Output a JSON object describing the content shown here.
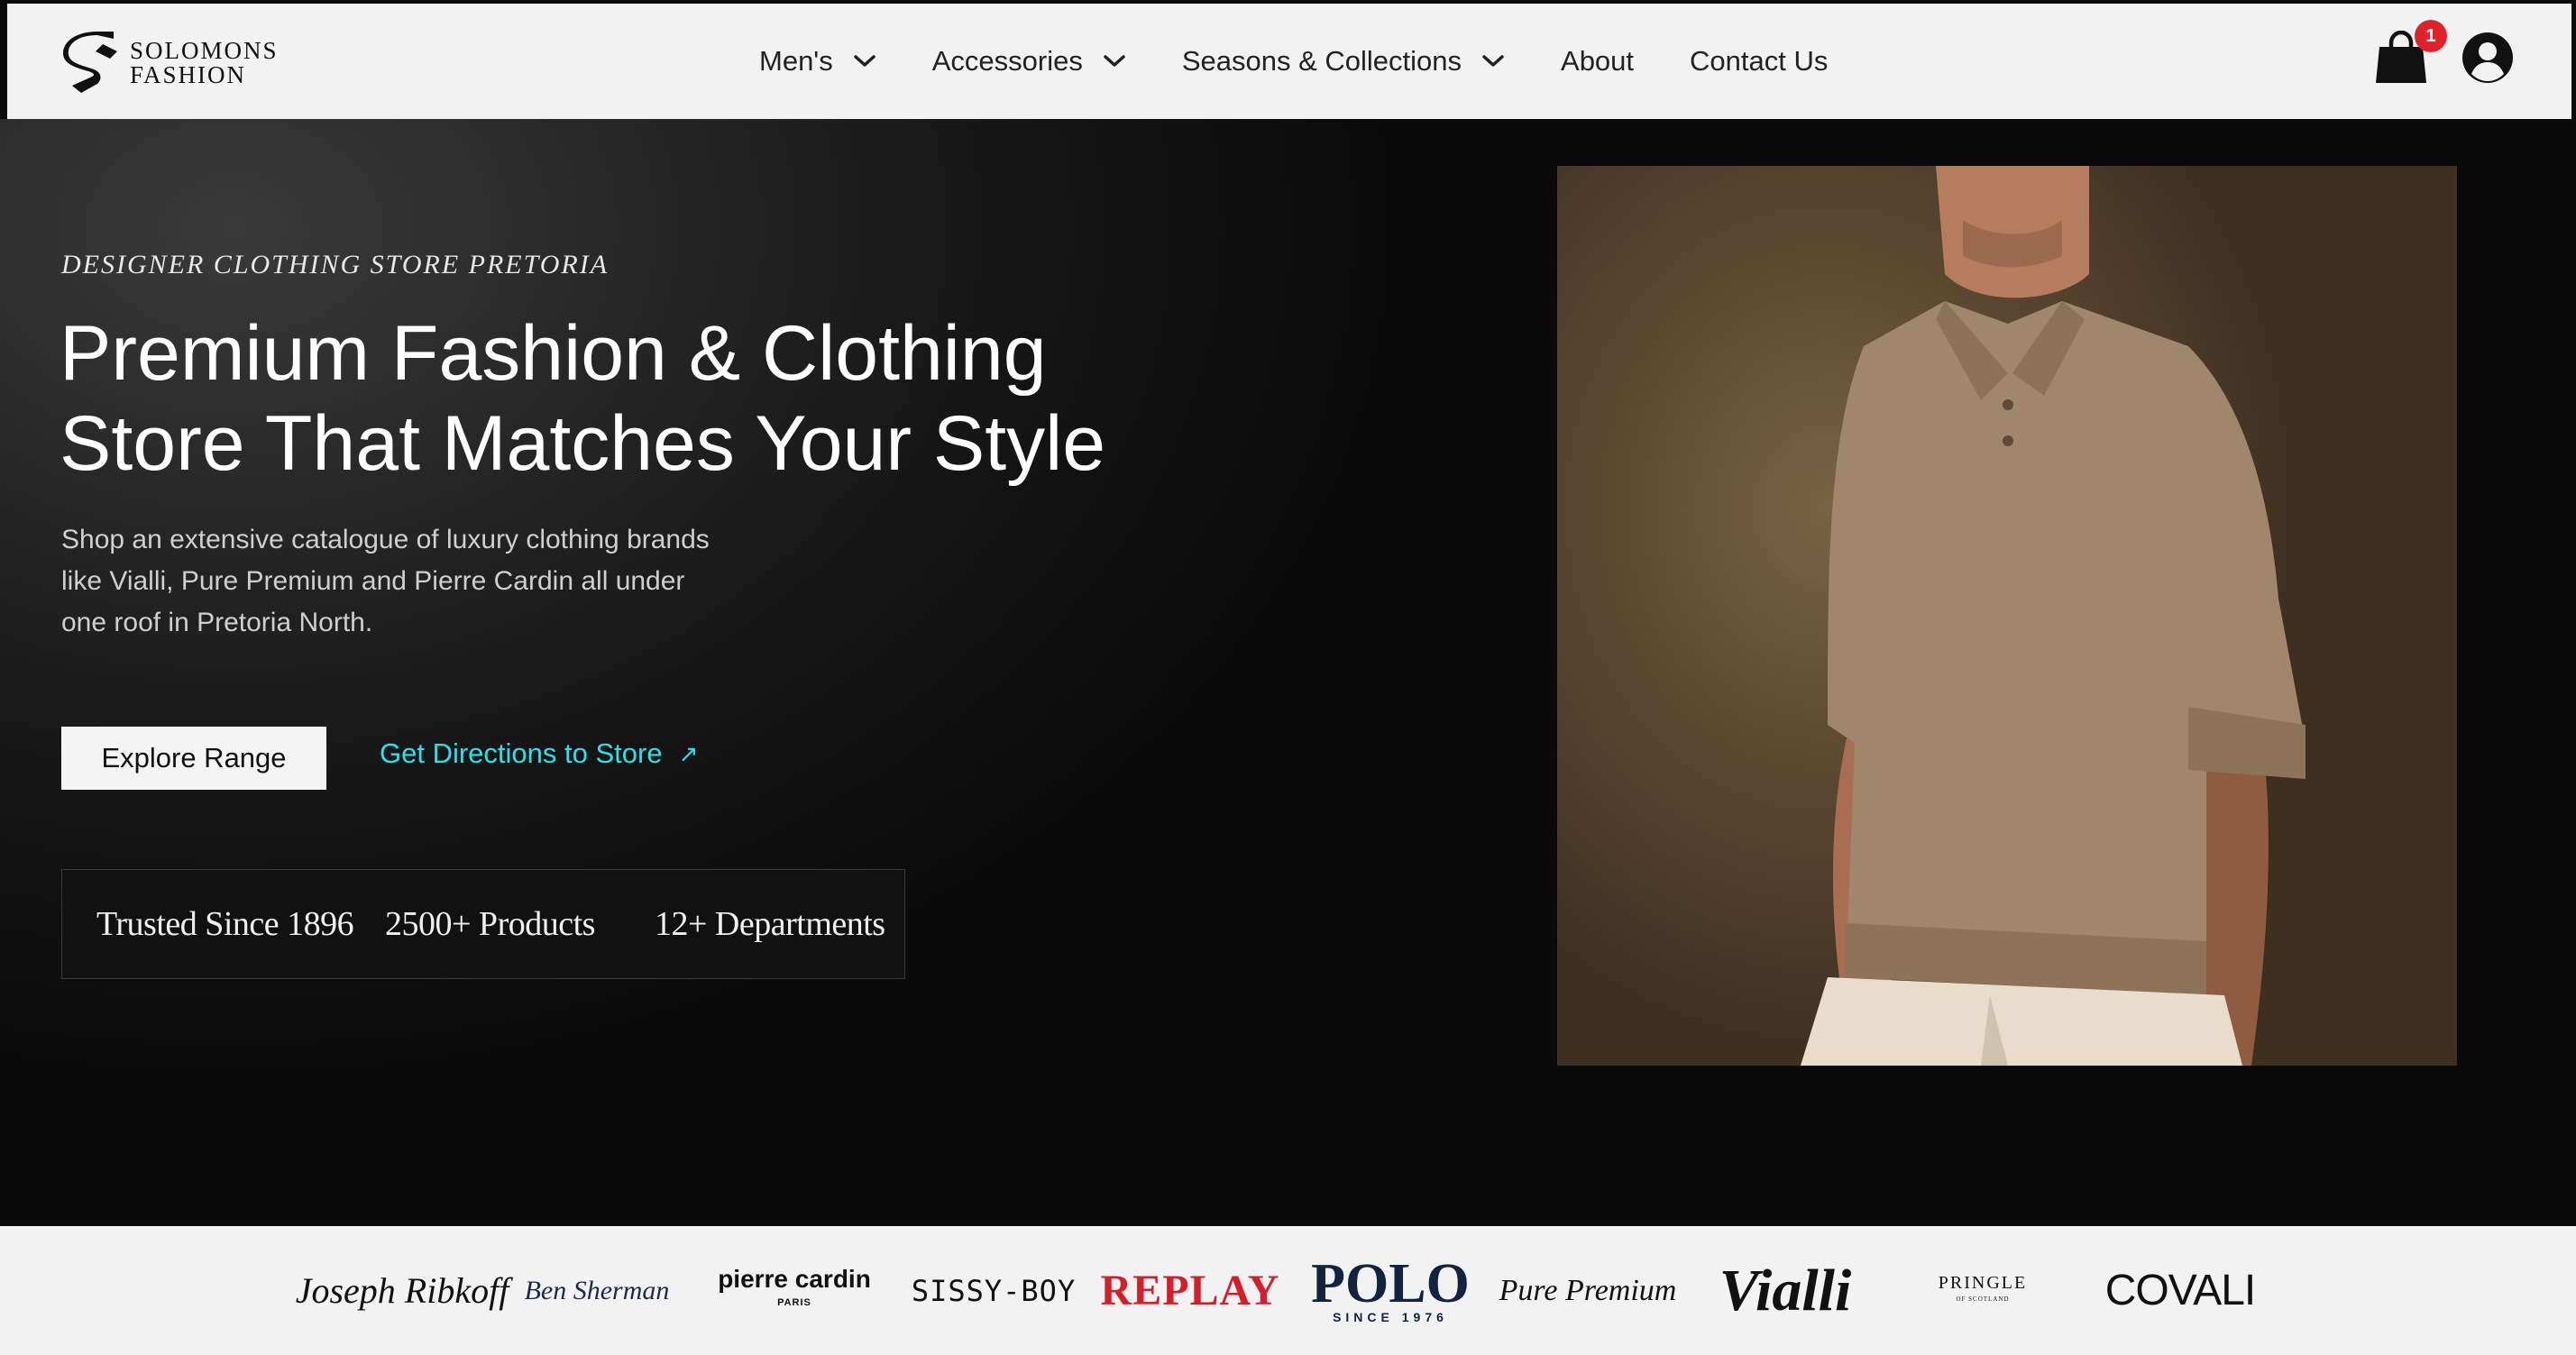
{
  "header": {
    "logo": {
      "line1": "SOLOMONS",
      "line2": "FASHION"
    },
    "nav": [
      {
        "label": "Men's",
        "has_dropdown": true
      },
      {
        "label": "Accessories",
        "has_dropdown": true
      },
      {
        "label": "Seasons & Collections",
        "has_dropdown": true
      },
      {
        "label": "About",
        "has_dropdown": false
      },
      {
        "label": "Contact Us",
        "has_dropdown": false
      }
    ],
    "cart_count": "1",
    "icons": [
      "shopping-bag-icon",
      "account-icon"
    ]
  },
  "hero": {
    "eyebrow": "DESIGNER CLOTHING STORE PRETORIA",
    "headline_line1": "Premium Fashion & Clothing",
    "headline_line2": "Store That Matches Your Style",
    "subtext_line1": "Shop an extensive catalogue of luxury clothing brands",
    "subtext_line2": "like Vialli, Pure Premium and Pierre Cardin all under",
    "subtext_line3": "one roof in Pretoria North.",
    "primary_button": "Explore Range",
    "secondary_link": "Get Directions to Store",
    "secondary_link_arrow": "↗",
    "stats": [
      "Trusted Since 1896",
      "2500+ Products",
      "12+ Departments"
    ]
  },
  "brands": {
    "rib": "Joseph Ribkoff",
    "ben": "Ben Sherman",
    "pc": "pierre cardin",
    "pc_sub": "PARIS",
    "sissy": "SISSY-BOY",
    "replay": "REPLAY",
    "polo": "POLO",
    "polo_sub": "SINCE 1976",
    "pure": "Pure Premium",
    "vialli": "Vialli",
    "pringle": "PRINGLE",
    "pringle_sub": "OF SCOTLAND",
    "covali": "COVALI"
  },
  "colors": {
    "accent_link": "#2ee0ea",
    "badge": "#e0232e",
    "header_bg": "#f2f2f2",
    "hero_bg": "#0b0b0b"
  }
}
